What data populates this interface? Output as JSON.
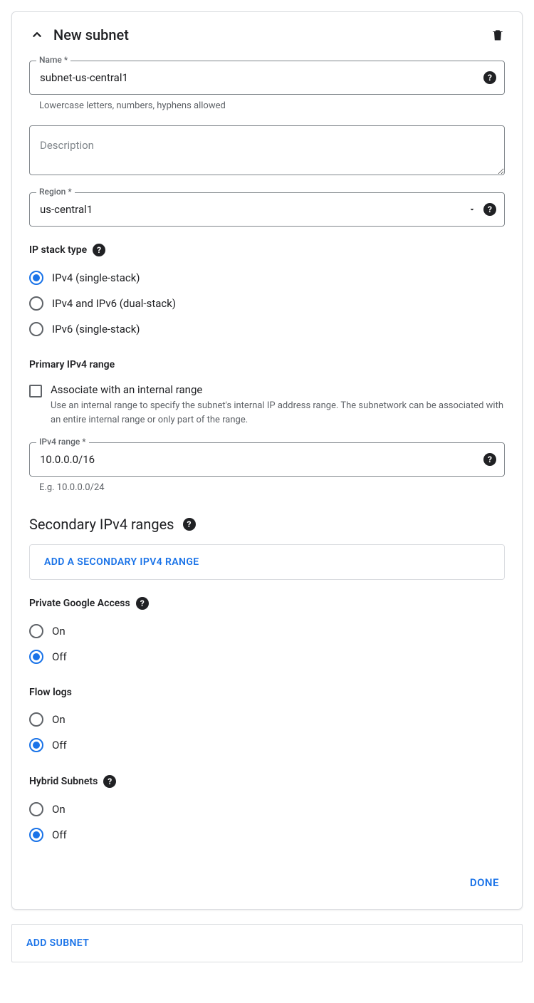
{
  "panel": {
    "title": "New subnet"
  },
  "name": {
    "label": "Name *",
    "value": "subnet-us-central1",
    "helper": "Lowercase letters, numbers, hyphens allowed"
  },
  "description": {
    "placeholder": "Description",
    "value": ""
  },
  "region": {
    "label": "Region *",
    "value": "us-central1"
  },
  "ipStackType": {
    "label": "IP stack type",
    "options": [
      "IPv4 (single-stack)",
      "IPv4 and IPv6 (dual-stack)",
      "IPv6 (single-stack)"
    ],
    "selected": 0
  },
  "primaryIpv4": {
    "label": "Primary IPv4 range",
    "associate": {
      "label": "Associate with an internal range",
      "desc": "Use an internal range to specify the subnet's internal IP address range. The subnetwork can be associated with an entire internal range or only part of the range.",
      "checked": false
    },
    "range": {
      "label": "IPv4 range *",
      "value": "10.0.0.0/16",
      "helper": "E.g. 10.0.0.0/24"
    }
  },
  "secondaryIpv4": {
    "heading": "Secondary IPv4 ranges",
    "addButton": "ADD A SECONDARY IPV4 RANGE"
  },
  "privateGoogleAccess": {
    "label": "Private Google Access",
    "options": [
      "On",
      "Off"
    ],
    "selected": 1
  },
  "flowLogs": {
    "label": "Flow logs",
    "options": [
      "On",
      "Off"
    ],
    "selected": 1
  },
  "hybridSubnets": {
    "label": "Hybrid Subnets",
    "options": [
      "On",
      "Off"
    ],
    "selected": 1
  },
  "actions": {
    "done": "DONE",
    "addSubnet": "ADD SUBNET"
  }
}
